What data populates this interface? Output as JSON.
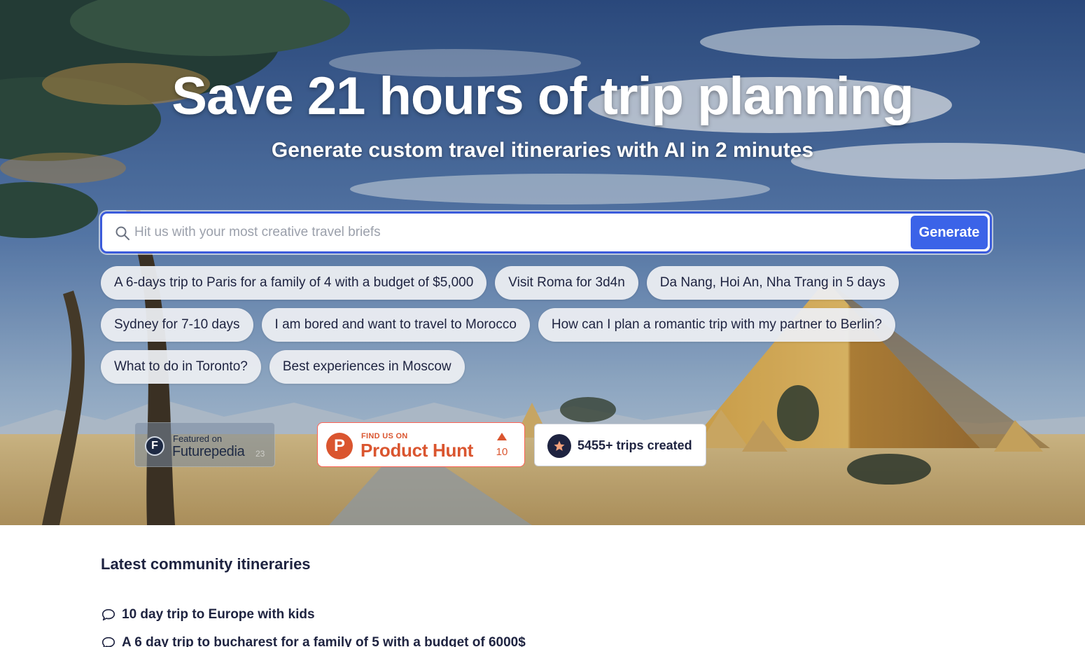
{
  "hero": {
    "headline": "Save 21 hours of trip planning",
    "subheadline": "Generate custom travel itineraries with AI in 2 minutes"
  },
  "search": {
    "icon": "search-icon",
    "placeholder": "Hit us with your most creative travel briefs",
    "value": "",
    "button_label": "Generate",
    "accent_color": "#3b63e8"
  },
  "suggestions": {
    "rows": [
      [
        "A 6-days trip to Paris for a family of 4 with a budget of $5,000",
        "Visit Roma for 3d4n",
        "Da Nang, Hoi An, Nha Trang in 5 days"
      ],
      [
        "Sydney for 7-10 days",
        "I am bored and want to travel to Morocco",
        "How can I plan a romantic trip with my partner to Berlin?"
      ],
      [
        "What to do in Toronto?",
        "Best experiences in Moscow"
      ]
    ]
  },
  "badges": {
    "futurepedia": {
      "small": "Featured on",
      "name": "Futurepedia",
      "count": "23"
    },
    "producthunt": {
      "small": "FIND US ON",
      "name": "Product Hunt",
      "votes": "10",
      "color": "#da552f"
    },
    "trips": {
      "text": "5455+ trips created",
      "icon": "star-icon"
    }
  },
  "community": {
    "title": "Latest community itineraries",
    "icon": "chat-bubble-icon",
    "items": [
      "10 day trip to Europe with kids",
      "A 6 day trip to bucharest for a family of 5 with a budget of 6000$"
    ]
  }
}
